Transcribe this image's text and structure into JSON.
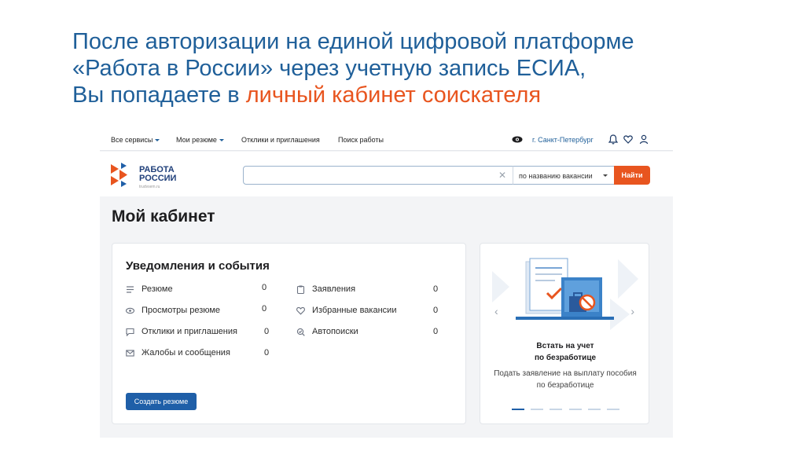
{
  "slide": {
    "title_line1": "После авторизации на единой цифровой платформе",
    "title_line2": "«Работа в России» через учетную запись ЕСИА,",
    "title_line3_prefix": "Вы попадаете в ",
    "title_line3_accent": "личный кабинет соискателя"
  },
  "topbar": {
    "menu_all_services": "Все сервисы",
    "menu_my_resumes": "Мои резюме",
    "menu_responses": "Отклики и приглашения",
    "menu_job_search": "Поиск работы",
    "city": "г. Санкт-Петербург"
  },
  "header": {
    "logo_line1": "РАБОТА",
    "logo_line2": "РОССИИ",
    "logo_sub": "trudvsem.ru",
    "search_placeholder": "",
    "search_mode": "по названию вакансии",
    "find_label": "Найти"
  },
  "main": {
    "page_title": "Мой кабинет",
    "notifications": {
      "title": "Уведомления и события",
      "left_items": [
        {
          "label": "Резюме",
          "count": "0",
          "icon": "list-icon"
        },
        {
          "label": "Просмотры резюме",
          "count": "0",
          "icon": "eye-icon"
        },
        {
          "label": "Отклики и приглашения",
          "count": "0",
          "icon": "chat-icon"
        },
        {
          "label": "Жалобы и сообщения",
          "count": "0",
          "icon": "mail-icon"
        }
      ],
      "right_items": [
        {
          "label": "Заявления",
          "count": "0",
          "icon": "clipboard-icon"
        },
        {
          "label": "Избранные вакансии",
          "count": "0",
          "icon": "heart-icon"
        },
        {
          "label": "Автопоиски",
          "count": "0",
          "icon": "autosearch-icon"
        }
      ],
      "create_button": "Создать резюме"
    },
    "promo": {
      "heading_line1": "Встать на учет",
      "heading_line2": "по безработице",
      "text_line1": "Подать заявление на выплату пособия",
      "text_line2": "по безработице",
      "slides_total": 6,
      "slide_active": 1
    }
  },
  "colors": {
    "title_blue": "#1f5f99",
    "accent_orange": "#e8551f",
    "button_blue": "#1f5fa8"
  }
}
